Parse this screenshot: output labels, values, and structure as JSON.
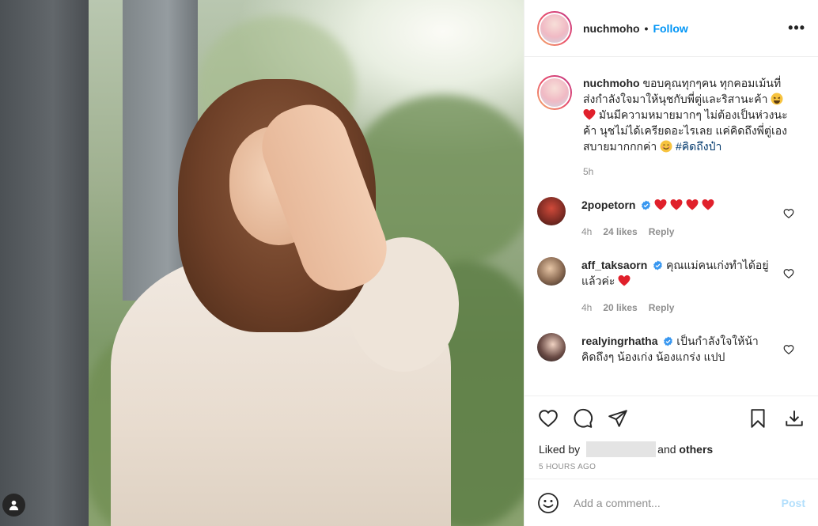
{
  "header": {
    "username": "nuchmoho",
    "separator": "•",
    "follow_label": "Follow",
    "more_label": "•••"
  },
  "caption": {
    "username": "nuchmoho",
    "text_part1": "ขอบคุณทุกๆคน ทุกคอมเม้นที่ส่งกำลังใจมาให้นุชกับพี่ตู่และริสานะค้า",
    "text_part2": " มันมีความหมายมากๆ ไม่ต้องเป็นห่วงนะค้า นุชไม่ได้เครียดอะไรเลย แค่คิดถึงพี่ตู่เอง สบายมากกกค่า",
    "hashtag": "#คิดถึงป๋า",
    "time": "5h"
  },
  "comments": [
    {
      "username": "2popetorn",
      "text": "",
      "hearts": 4,
      "time": "4h",
      "likes": "24 likes",
      "reply": "Reply"
    },
    {
      "username": "aff_taksaorn",
      "text": "คุณแม่คนเก่งทำได้อยู่แล้วค่ะ",
      "hearts": 1,
      "time": "4h",
      "likes": "20 likes",
      "reply": "Reply"
    },
    {
      "username": "realyingrhatha",
      "text": "เป็นกำลังใจให้น้า คิดถึงๆ น้องเก่ง น้องแกร่ง แปป",
      "hearts": 0,
      "time": "",
      "likes": "",
      "reply": ""
    }
  ],
  "likes": {
    "prefix": "Liked by",
    "suffix_and": "and",
    "suffix_others": "others"
  },
  "timestamp": "5 HOURS AGO",
  "add_comment": {
    "placeholder": "Add a comment...",
    "post_label": "Post"
  },
  "colors": {
    "accent": "#0095f6",
    "heart": "#ed4956",
    "verified": "#3897f0",
    "muted": "#8e8e8e"
  },
  "icons": [
    "tag-user-icon",
    "more-icon",
    "heart-icon",
    "comment-icon",
    "share-icon",
    "bookmark-icon",
    "download-icon",
    "smile-icon",
    "verified-icon"
  ]
}
